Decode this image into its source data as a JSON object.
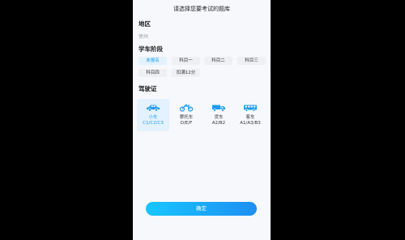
{
  "header": {
    "title": "请选择您要考试的题库"
  },
  "region": {
    "label": "地区",
    "value": "徐州"
  },
  "stage": {
    "label": "学车阶段",
    "options": [
      "未报名",
      "科目一",
      "科目二",
      "科目三",
      "科目四",
      "扣满12分"
    ],
    "selected": "未报名"
  },
  "license": {
    "label": "驾驶证",
    "items": [
      {
        "name": "小车",
        "code": "C1/C2/C3",
        "icon": "car-icon"
      },
      {
        "name": "摩托车",
        "code": "D/E/F",
        "icon": "motorcycle-icon"
      },
      {
        "name": "货车",
        "code": "A2/B2",
        "icon": "truck-icon"
      },
      {
        "name": "客车",
        "code": "A1/A3/B3",
        "icon": "bus-icon"
      }
    ],
    "selected": "小车"
  },
  "confirm_label": "确定",
  "colors": {
    "accent": "#1e9bf0",
    "selected_bg": "#e3f2fd",
    "chip_bg": "#eef0f3"
  }
}
